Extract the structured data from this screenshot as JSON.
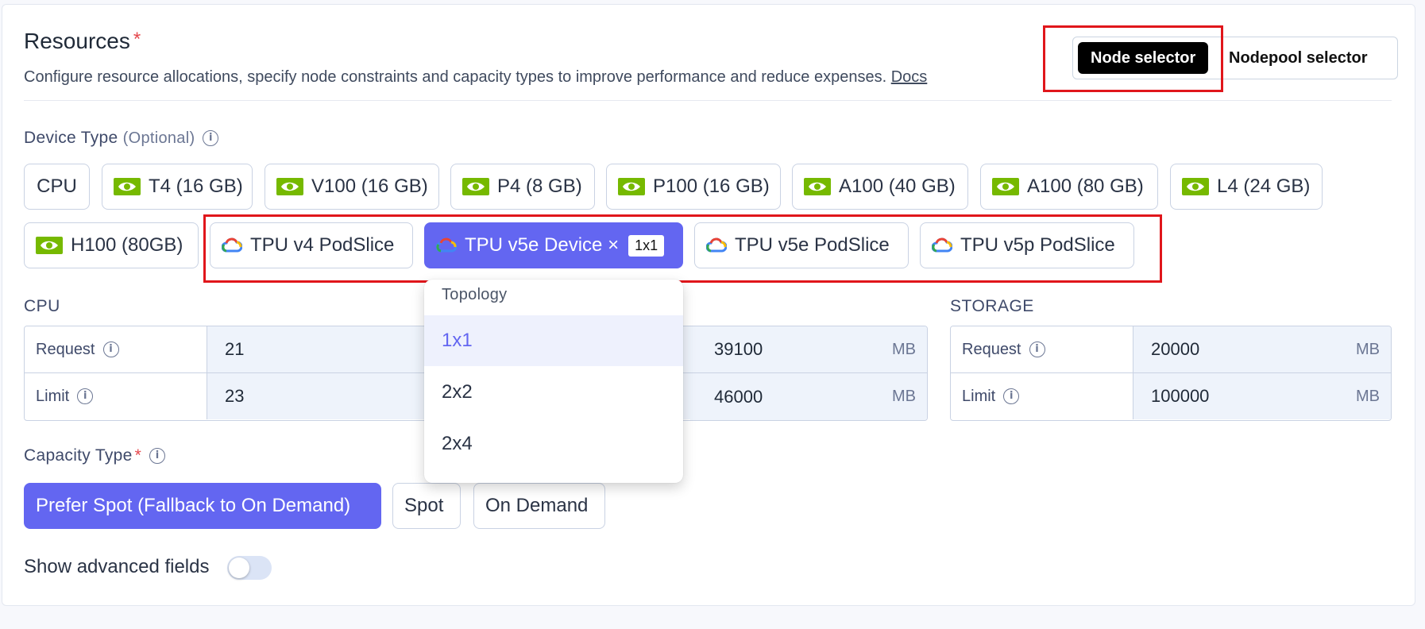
{
  "header": {
    "title": "Resources",
    "required_mark": "*",
    "description": "Configure resource allocations, specify node constraints and capacity types to improve performance and reduce expenses.",
    "docs_link": "Docs"
  },
  "selector": {
    "node_selector": "Node selector",
    "nodepool_selector": "Nodepool selector",
    "active": "Node selector"
  },
  "device_type": {
    "label": "Device Type",
    "optional": "(Optional)",
    "options": [
      {
        "label": "CPU",
        "icon": "none"
      },
      {
        "label": "T4 (16 GB)",
        "icon": "nvidia-icon"
      },
      {
        "label": "V100 (16 GB)",
        "icon": "nvidia-icon"
      },
      {
        "label": "P4 (8 GB)",
        "icon": "nvidia-icon"
      },
      {
        "label": "P100 (16 GB)",
        "icon": "nvidia-icon"
      },
      {
        "label": "A100 (40 GB)",
        "icon": "nvidia-icon"
      },
      {
        "label": "A100 (80 GB)",
        "icon": "nvidia-icon"
      },
      {
        "label": "L4 (24 GB)",
        "icon": "nvidia-icon"
      },
      {
        "label": "H100 (80GB)",
        "icon": "nvidia-icon"
      },
      {
        "label": "TPU v4 PodSlice",
        "icon": "google-cloud-icon"
      },
      {
        "label": "TPU v5e Device",
        "icon": "google-cloud-icon",
        "selected": true,
        "close": "×",
        "badge": "1x1"
      },
      {
        "label": "TPU v5e PodSlice",
        "icon": "google-cloud-icon"
      },
      {
        "label": "TPU v5p PodSlice",
        "icon": "google-cloud-icon"
      }
    ]
  },
  "resources": {
    "cpu": {
      "label": "CPU",
      "request_label": "Request",
      "request_value": "21",
      "limit_label": "Limit",
      "limit_value": "23"
    },
    "memory": {
      "request_value": "39100",
      "limit_value": "46000",
      "unit": "MB"
    },
    "storage": {
      "label": "STORAGE",
      "request_label": "Request",
      "request_value": "20000",
      "limit_label": "Limit",
      "limit_value": "100000",
      "unit": "MB"
    }
  },
  "topology_dropdown": {
    "title": "Topology",
    "options": [
      "1x1",
      "2x2",
      "2x4"
    ],
    "selected": "1x1"
  },
  "capacity_type": {
    "label": "Capacity Type",
    "required_mark": "*",
    "options": [
      "Prefer Spot (Fallback to On Demand)",
      "Spot",
      "On Demand"
    ],
    "selected": "Prefer Spot (Fallback to On Demand)"
  },
  "advanced": {
    "label": "Show advanced fields",
    "enabled": false
  },
  "colors": {
    "accent": "#6366f1",
    "highlight_box": "#e0161b",
    "nvidia": "#76b900"
  }
}
